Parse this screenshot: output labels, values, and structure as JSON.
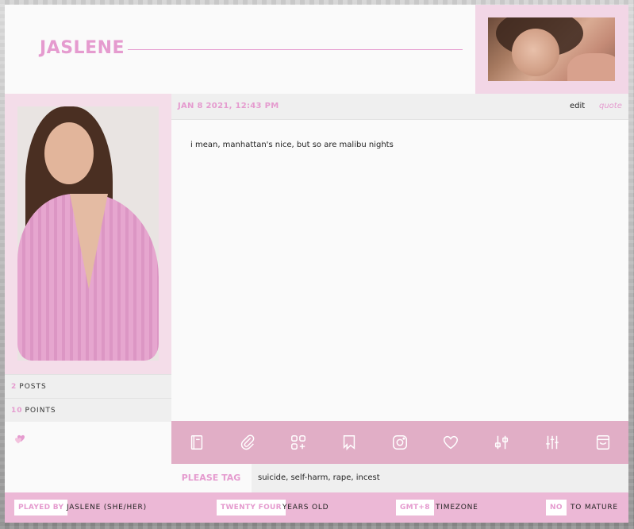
{
  "header": {
    "name": "JASLENE"
  },
  "post": {
    "date": "JAN 8 2021, 12:43 PM",
    "edit_label": "edit",
    "quote_label": "quote",
    "text": "i mean, manhattan's nice, but so are malibu nights"
  },
  "sidebar": {
    "posts_count": "2",
    "posts_label": "POSTS",
    "points_count": "10",
    "points_label": "POINTS"
  },
  "icons": [
    "notebook-icon",
    "paperclip-icon",
    "grid-plus-icon",
    "bookmark-icon",
    "instagram-icon",
    "heart-outline-icon",
    "sliders-vertical-icon",
    "sliders-horizontal-icon",
    "inbox-icon"
  ],
  "tags": {
    "label": "PLEASE TAG",
    "value": "suicide, self-harm, rape, incest"
  },
  "footer": {
    "played_by_label": "PLAYED BY",
    "played_by_value": "JASLENE (SHE/HER)",
    "age_label": "TWENTY FOUR",
    "age_value": "YEARS OLD",
    "tz_label": "GMT+8",
    "tz_value": "TIMEZONE",
    "mature_label": "NO",
    "mature_value": "TO MATURE"
  },
  "colors": {
    "accent": "#e59bcf",
    "icon_bar": "#e1aec6",
    "footer": "#ecb8d6",
    "frame": "#f4dde9"
  }
}
